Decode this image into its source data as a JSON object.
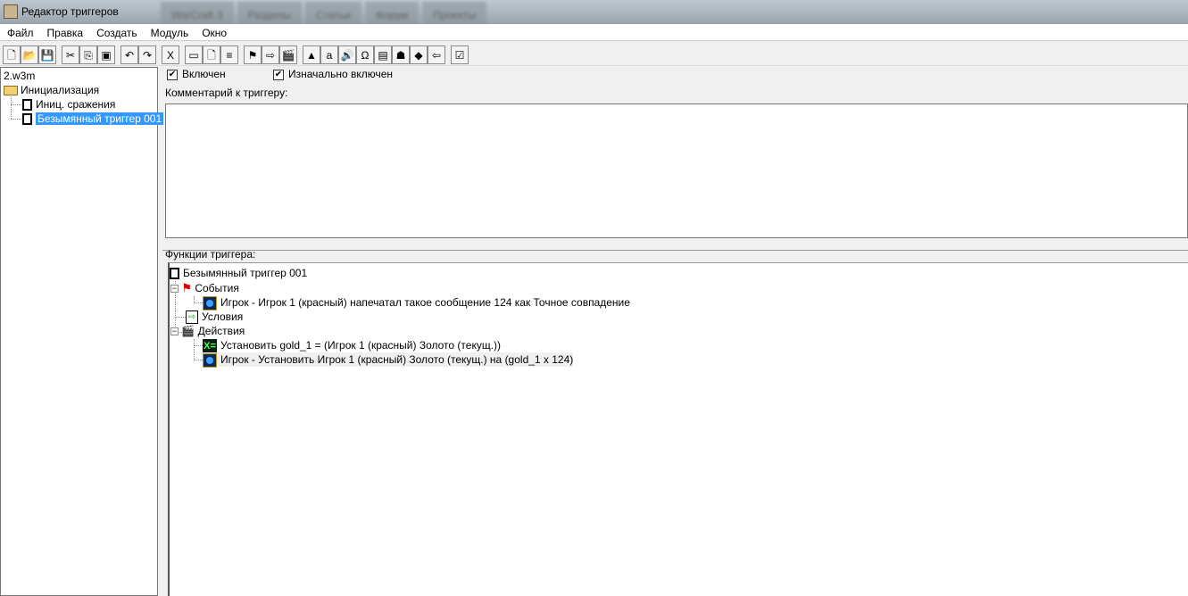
{
  "window": {
    "title": "Редактор триггеров",
    "background_tabs": [
      "WarCraft 3",
      "Разделы",
      "Статьи",
      "Форум",
      "Проекты"
    ]
  },
  "menu": [
    "Файл",
    "Правка",
    "Создать",
    "Модуль",
    "Окно"
  ],
  "toolbar": {
    "groups": [
      [
        "new-icon",
        "open-icon",
        "save-icon"
      ],
      [
        "cut-icon",
        "copy-icon",
        "paste-icon"
      ],
      [
        "undo-icon",
        "redo-icon"
      ],
      [
        "variables-icon"
      ],
      [
        "new-category-icon",
        "new-trigger-icon",
        "new-comment-icon"
      ],
      [
        "new-event-icon",
        "new-condition-icon",
        "new-action-icon"
      ],
      [
        "terrain-editor-icon",
        "trigger-editor-icon",
        "sound-editor-icon",
        "object-editor-icon",
        "campaign-editor-icon",
        "ai-editor-icon",
        "object-manager-icon",
        "import-manager-icon"
      ],
      [
        "test-map-icon"
      ]
    ],
    "glyphs": {
      "new-icon": "🗋",
      "open-icon": "📂",
      "save-icon": "💾",
      "cut-icon": "✂",
      "copy-icon": "⎘",
      "paste-icon": "▣",
      "undo-icon": "↶",
      "redo-icon": "↷",
      "variables-icon": "X",
      "new-category-icon": "▭",
      "new-trigger-icon": "🗋",
      "new-comment-icon": "≡",
      "new-event-icon": "⚑",
      "new-condition-icon": "⇨",
      "new-action-icon": "🎬",
      "terrain-editor-icon": "▲",
      "trigger-editor-icon": "a",
      "sound-editor-icon": "🔊",
      "object-editor-icon": "Ω",
      "campaign-editor-icon": "▤",
      "ai-editor-icon": "☗",
      "object-manager-icon": "◆",
      "import-manager-icon": "⇦",
      "test-map-icon": "☑"
    }
  },
  "tree": {
    "root": "2.w3m",
    "category": "Инициализация",
    "triggers": [
      "Иниц. сражения",
      "Безымянный триггер 001"
    ],
    "selected": 1
  },
  "trigger": {
    "enabled_label": "Включен",
    "initially_on_label": "Изначально включен",
    "enabled": true,
    "initially_on": true,
    "comment_label": "Комментарий к триггеру:",
    "comment": "",
    "functions_label": "Функции триггера:"
  },
  "functions": {
    "name": "Безымянный триггер 001",
    "events_label": "События",
    "event": "Игрок - Игрок 1 (красный) напечатал такое сообщение 124 как Точное совпадение",
    "conditions_label": "Условия",
    "actions_label": "Действия",
    "actions": [
      "Установить gold_1 = (Игрок 1 (красный) Золото (текущ.))",
      "Игрок - Установить Игрок 1 (красный) Золото (текущ.) на (gold_1 x 124)"
    ]
  }
}
